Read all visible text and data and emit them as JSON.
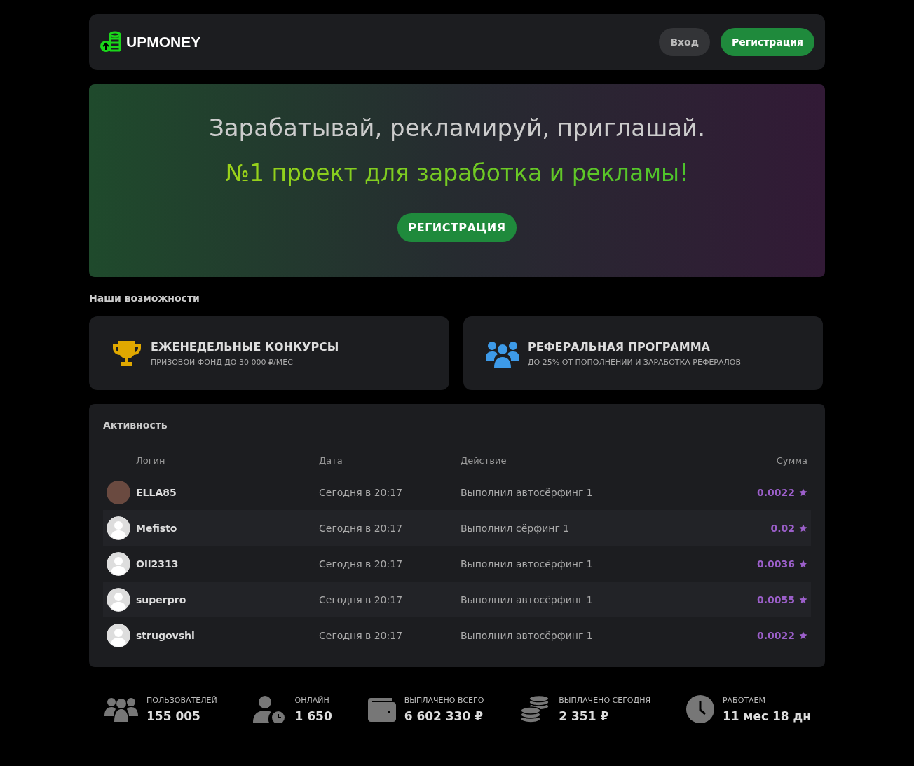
{
  "header": {
    "logo": "UPMONEY",
    "buttons": [
      {
        "label": "Вход",
        "kind": "secondary"
      },
      {
        "label": "Регистрация",
        "kind": "primary"
      }
    ]
  },
  "hero": {
    "title": "Зарабатывай, рекламируй, приглашай.",
    "subtitle": "№1 проект для заработка и рекламы!",
    "button": "РЕГИСТРАЦИЯ"
  },
  "features": {
    "title": "Наши возможности",
    "items": [
      {
        "kind": "trophy",
        "title": "ЕЖЕНЕДЕЛЬНЫЕ КОНКУРСЫ",
        "subtitle": "ПРИЗОВОЙ ФОНД ДО 30 000 ₽/МЕС"
      },
      {
        "kind": "users",
        "title": "РЕФЕРАЛЬНАЯ ПРОГРАММА",
        "subtitle": "ДО 25% ОТ ПОПОЛНЕНИЙ И ЗАРАБОТКА РЕФЕРАЛОВ"
      }
    ]
  },
  "activity": {
    "title": "Активность",
    "columns": [
      "Логин",
      "Дата",
      "Действие",
      "Сумма"
    ],
    "rows": [
      {
        "avatar": {
          "kind": "photo"
        },
        "login": "ELLA85",
        "date": "Сегодня в 20:17",
        "action": "Выполнил автосёрфинг 1",
        "amount": "0.0022"
      },
      {
        "avatar": {
          "kind": "default"
        },
        "login": "Mefisto",
        "date": "Сегодня в 20:17",
        "action": "Выполнил сёрфинг 1",
        "amount": "0.02"
      },
      {
        "avatar": {
          "kind": "default"
        },
        "login": "Oll2313",
        "date": "Сегодня в 20:17",
        "action": "Выполнил автосёрфинг 1",
        "amount": "0.0036"
      },
      {
        "avatar": {
          "kind": "default"
        },
        "login": "superpro",
        "date": "Сегодня в 20:17",
        "action": "Выполнил автосёрфинг 1",
        "amount": "0.0055"
      },
      {
        "avatar": {
          "kind": "default"
        },
        "login": "strugovshi",
        "date": "Сегодня в 20:17",
        "action": "Выполнил автосёрфинг 1",
        "amount": "0.0022"
      }
    ]
  },
  "stats": [
    {
      "kind": "users",
      "label": "ПОЛЬЗОВАТЕЛЕЙ",
      "value": "155 005"
    },
    {
      "kind": "online",
      "label": "ОНЛАЙН",
      "value": "1 650"
    },
    {
      "kind": "wallet",
      "label": "ВЫПЛАЧЕНО ВСЕГО",
      "value": "6 602 330 ₽"
    },
    {
      "kind": "coins",
      "label": "ВЫПЛАЧЕНО СЕГОДНЯ",
      "value": "2 351 ₽"
    },
    {
      "kind": "clock",
      "label": "РАБОТАЕМ",
      "value": "11 мес 18 дн"
    }
  ]
}
